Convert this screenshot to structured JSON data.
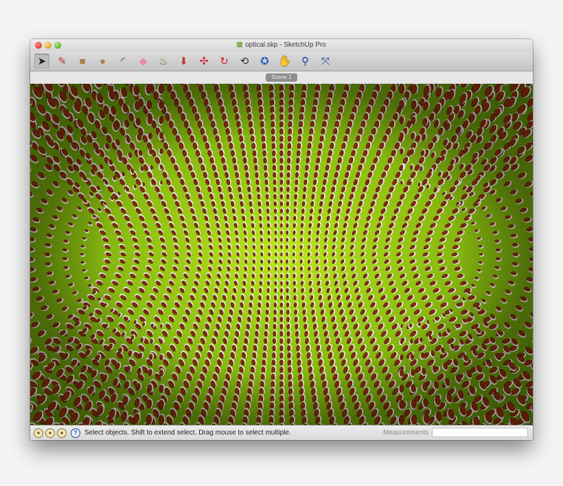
{
  "window": {
    "title": "optical.skp - SketchUp Pro"
  },
  "toolbar": {
    "tools": [
      {
        "name": "select-tool",
        "icon": "arrow-cursor-icon",
        "glyph": "➤",
        "color": "#222222",
        "active": true
      },
      {
        "name": "line-tool",
        "icon": "pencil-icon",
        "glyph": "✎",
        "color": "#c0392b"
      },
      {
        "name": "rectangle-tool",
        "icon": "rectangle-icon",
        "glyph": "■",
        "color": "#a7804a"
      },
      {
        "name": "circle-tool",
        "icon": "circle-icon",
        "glyph": "●",
        "color": "#a7804a"
      },
      {
        "name": "arc-tool",
        "icon": "arc-icon",
        "glyph": "◜",
        "color": "#333333"
      },
      {
        "name": "eraser-tool",
        "icon": "eraser-icon",
        "glyph": "◆",
        "color": "#e98aa8"
      },
      {
        "name": "paint-bucket-tool",
        "icon": "paint-bucket-icon",
        "glyph": "♨",
        "color": "#7a5a2a"
      },
      {
        "name": "push-pull-tool",
        "icon": "push-pull-icon",
        "glyph": "⬇",
        "color": "#c0392b"
      },
      {
        "name": "move-tool",
        "icon": "move-icon",
        "glyph": "✣",
        "color": "#d0202a"
      },
      {
        "name": "rotate-tool",
        "icon": "rotate-icon",
        "glyph": "↻",
        "color": "#d0202a"
      },
      {
        "name": "offset-tool",
        "icon": "offset-icon",
        "glyph": "⟲",
        "color": "#333333"
      },
      {
        "name": "orbit-tool",
        "icon": "orbit-icon",
        "glyph": "✪",
        "color": "#2a5fbf"
      },
      {
        "name": "pan-tool",
        "icon": "hand-icon",
        "glyph": "✋",
        "color": "#ffffff"
      },
      {
        "name": "zoom-tool",
        "icon": "magnifier-icon",
        "glyph": "⚲",
        "color": "#1f3f9a"
      },
      {
        "name": "zoom-extents-tool",
        "icon": "zoom-extents-icon",
        "glyph": "⤧",
        "color": "#1f3f9a"
      }
    ]
  },
  "scene_tab": {
    "label": "Scene 1"
  },
  "status": {
    "message": "Select objects. Shift to extend select. Drag mouse to select multiple.",
    "measurements_label": "Measurements",
    "measurements_value": ""
  },
  "colors": {
    "background_green": "#a3d314",
    "dot_fill": "#8a2e0a",
    "dot_highlight": "#f2f0e0"
  }
}
